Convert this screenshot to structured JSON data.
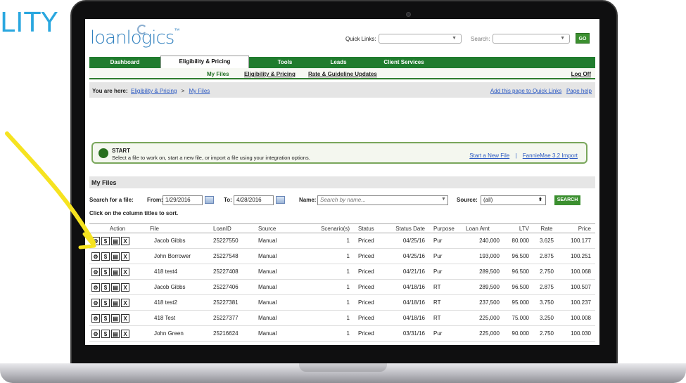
{
  "page_heading_fragment": "LITY",
  "header": {
    "logo": "loanlogics",
    "logo_mark": "™",
    "quick_links_label": "Quick Links:",
    "search_label": "Search:",
    "go_label": "GO"
  },
  "nav": {
    "tabs": [
      "Dashboard",
      "Eligibility & Pricing",
      "Tools",
      "Leads",
      "Client Services"
    ],
    "subnav": [
      "My Files",
      "Eligibility & Pricing",
      "Rate & Guideline Updates"
    ],
    "logoff": "Log Off"
  },
  "breadcrumb": {
    "prefix": "You are here:",
    "items": [
      "Eligibility & Pricing",
      "My Files"
    ],
    "separator": ">",
    "right_links": [
      "Add this page to Quick Links",
      "Page help"
    ]
  },
  "start": {
    "title": "START",
    "subtitle": "Select a file to work on, start a new file, or import a file using your integration options.",
    "links": [
      "Start a New File",
      "FannieMae 3.2 Import"
    ],
    "separator": "|"
  },
  "my_files": {
    "title": "My Files",
    "search_label": "Search for a file:",
    "from_label": "From:",
    "from_value": "1/29/2016",
    "to_label": "To:",
    "to_value": "4/28/2016",
    "name_label": "Name:",
    "name_placeholder": "Search by name...",
    "source_label": "Source:",
    "source_value": "(all)",
    "search_button": "SEARCH",
    "sort_note": "Click on the column titles to sort."
  },
  "table": {
    "columns": [
      "Action",
      "File",
      "LoanID",
      "Source",
      "Scenario(s)",
      "Status",
      "Status Date",
      "Purpose",
      "Loan Amt",
      "LTV",
      "Rate",
      "Price"
    ],
    "action_icons": [
      "gear-icon",
      "dollar-icon",
      "document-icon",
      "delete-icon"
    ],
    "action_glyphs": [
      "⚙",
      "$",
      "▤",
      "X"
    ],
    "rows": [
      [
        "Jacob Gibbs",
        "25227550",
        "Manual",
        "1",
        "Priced",
        "04/25/16",
        "Pur",
        "240,000",
        "80.000",
        "3.625",
        "100.177"
      ],
      [
        "John Borrower",
        "25227548",
        "Manual",
        "1",
        "Priced",
        "04/25/16",
        "Pur",
        "193,000",
        "96.500",
        "2.875",
        "100.251"
      ],
      [
        "418 test4",
        "25227408",
        "Manual",
        "1",
        "Priced",
        "04/21/16",
        "Pur",
        "289,500",
        "96.500",
        "2.750",
        "100.068"
      ],
      [
        "Jacob Gibbs",
        "25227406",
        "Manual",
        "1",
        "Priced",
        "04/18/16",
        "RT",
        "289,500",
        "96.500",
        "2.875",
        "100.507"
      ],
      [
        "418 test2",
        "25227381",
        "Manual",
        "1",
        "Priced",
        "04/18/16",
        "RT",
        "237,500",
        "95.000",
        "3.750",
        "100.237"
      ],
      [
        "418 Test",
        "25227377",
        "Manual",
        "1",
        "Priced",
        "04/18/16",
        "RT",
        "225,000",
        "75.000",
        "3.250",
        "100.008"
      ],
      [
        "John Green",
        "25216624",
        "Manual",
        "1",
        "Priced",
        "03/31/16",
        "Pur",
        "225,000",
        "90.000",
        "2.750",
        "100.030"
      ]
    ]
  },
  "colors": {
    "brand_green": "#207c2e",
    "accent_blue": "#2aa7df",
    "annotation_yellow": "#f6e320"
  }
}
